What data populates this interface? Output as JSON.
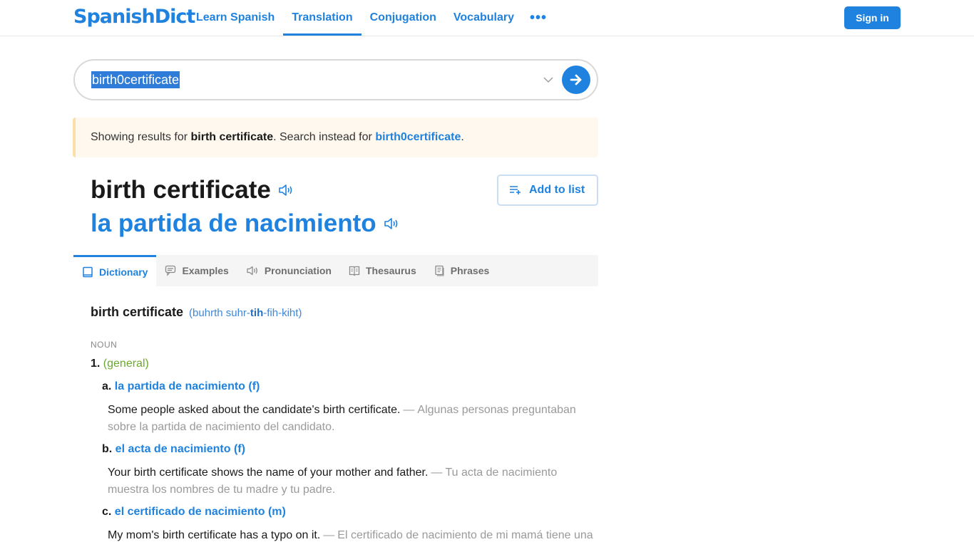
{
  "header": {
    "logo": "SpanishDict",
    "nav": [
      {
        "label": "Learn Spanish",
        "active": false
      },
      {
        "label": "Translation",
        "active": true
      },
      {
        "label": "Conjugation",
        "active": false
      },
      {
        "label": "Vocabulary",
        "active": false
      }
    ],
    "more_icon": "ellipsis-icon",
    "more_label": "•••",
    "signin_label": "Sign in"
  },
  "search": {
    "value": "birth0certificate",
    "dropdown_icon": "chevron-down-icon",
    "submit_icon": "arrow-right-icon"
  },
  "notice": {
    "prefix": "Showing results for ",
    "corrected": "birth certificate",
    "middle": ". Search instead for ",
    "original": "birth0certificate",
    "suffix": "."
  },
  "headword": {
    "word": "birth certificate",
    "translation": "la partida de nacimiento",
    "speaker_icon": "speaker-icon",
    "add_to_list_label": "Add to list",
    "add_to_list_icon": "playlist-add-icon"
  },
  "tabs": [
    {
      "label": "Dictionary",
      "icon": "book-icon",
      "active": true
    },
    {
      "label": "Examples",
      "icon": "chat-icon",
      "active": false
    },
    {
      "label": "Pronunciation",
      "icon": "speaker-icon",
      "active": false
    },
    {
      "label": "Thesaurus",
      "icon": "open-book-icon",
      "active": false
    },
    {
      "label": "Phrases",
      "icon": "document-icon",
      "active": false
    }
  ],
  "entry": {
    "word": "birth certificate",
    "pron_open": "(buhrth suhr-",
    "pron_stress": "tih",
    "pron_close": "-fih-kiht)",
    "pos": "NOUN",
    "sense_num": "1.",
    "sense_context": "(general)",
    "translations": [
      {
        "letter": "a.",
        "word": "la partida de nacimiento (f)",
        "example_en": "Some people asked about the candidate's birth certificate.",
        "example_es": "Algunas personas preguntaban sobre la partida de nacimiento del candidato."
      },
      {
        "letter": "b.",
        "word": "el acta de nacimiento (f)",
        "example_en": "Your birth certificate shows the name of your mother and father.",
        "example_es": "Tu acta de nacimiento muestra los nombres de tu madre y tu padre."
      },
      {
        "letter": "c.",
        "word": "el certificado de nacimiento (m)",
        "example_en": "My mom's birth certificate has a typo on it.",
        "example_es": "El certificado de nacimiento de mi mamá tiene una"
      }
    ],
    "dash": "—"
  },
  "colors": {
    "brand_blue": "#1f82de",
    "context_green": "#69a92b",
    "notice_bg": "#fef8ee",
    "notice_border": "#fbe0a6"
  }
}
